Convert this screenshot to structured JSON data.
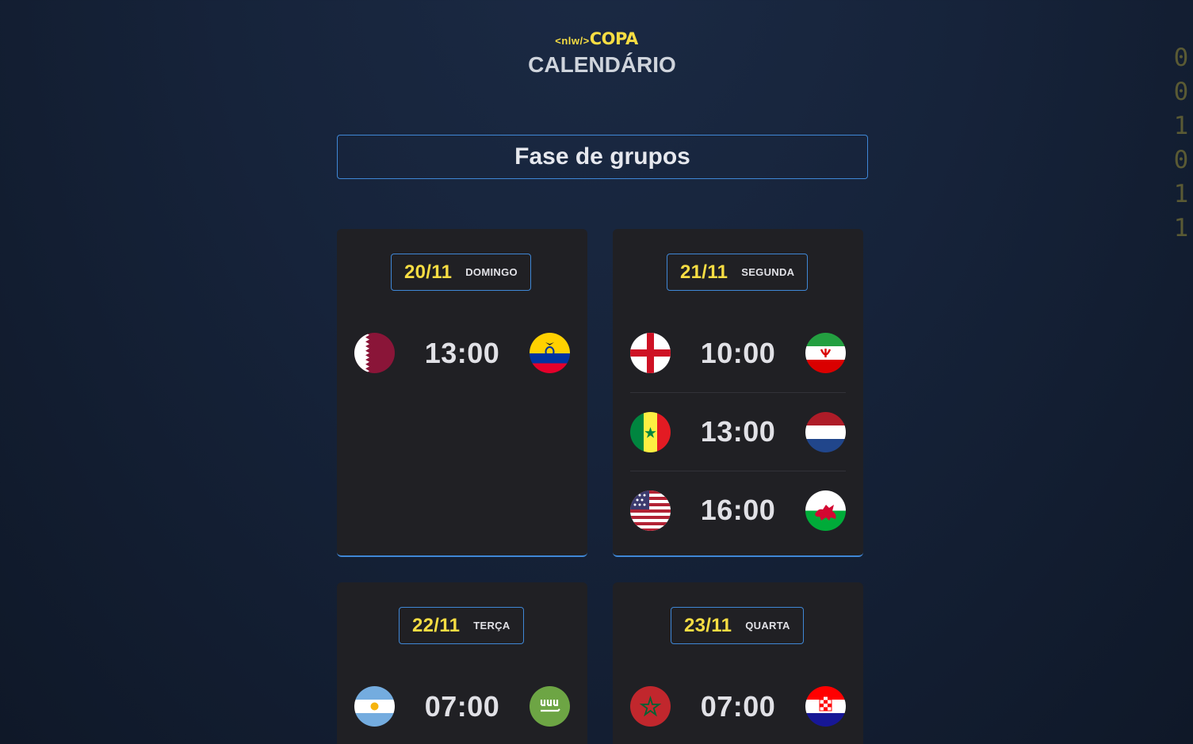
{
  "header": {
    "logo_prefix": "<nlw/>",
    "logo_name": "COPA",
    "title": "CALENDÁRIO"
  },
  "decor": {
    "binary_digits": [
      "0",
      "0",
      "1",
      "0",
      "1",
      "1"
    ]
  },
  "phase": {
    "label": "Fase de grupos"
  },
  "days": [
    {
      "date": "20/11",
      "weekday": "DOMINGO",
      "games": [
        {
          "home_flag": "qatar-flag-icon",
          "time": "13:00",
          "away_flag": "ecuador-flag-icon"
        }
      ]
    },
    {
      "date": "21/11",
      "weekday": "SEGUNDA",
      "games": [
        {
          "home_flag": "england-flag-icon",
          "time": "10:00",
          "away_flag": "iran-flag-icon"
        },
        {
          "home_flag": "senegal-flag-icon",
          "time": "13:00",
          "away_flag": "netherlands-flag-icon"
        },
        {
          "home_flag": "usa-flag-icon",
          "time": "16:00",
          "away_flag": "wales-flag-icon"
        }
      ]
    },
    {
      "date": "22/11",
      "weekday": "TERÇA",
      "games": [
        {
          "home_flag": "argentina-flag-icon",
          "time": "07:00",
          "away_flag": "saudi-arabia-flag-icon"
        }
      ]
    },
    {
      "date": "23/11",
      "weekday": "QUARTA",
      "games": [
        {
          "home_flag": "morocco-flag-icon",
          "time": "07:00",
          "away_flag": "croatia-flag-icon"
        }
      ]
    }
  ],
  "colors": {
    "accent_yellow": "#f7dd43",
    "accent_blue": "#3f87d6",
    "card_bg": "#202024"
  }
}
